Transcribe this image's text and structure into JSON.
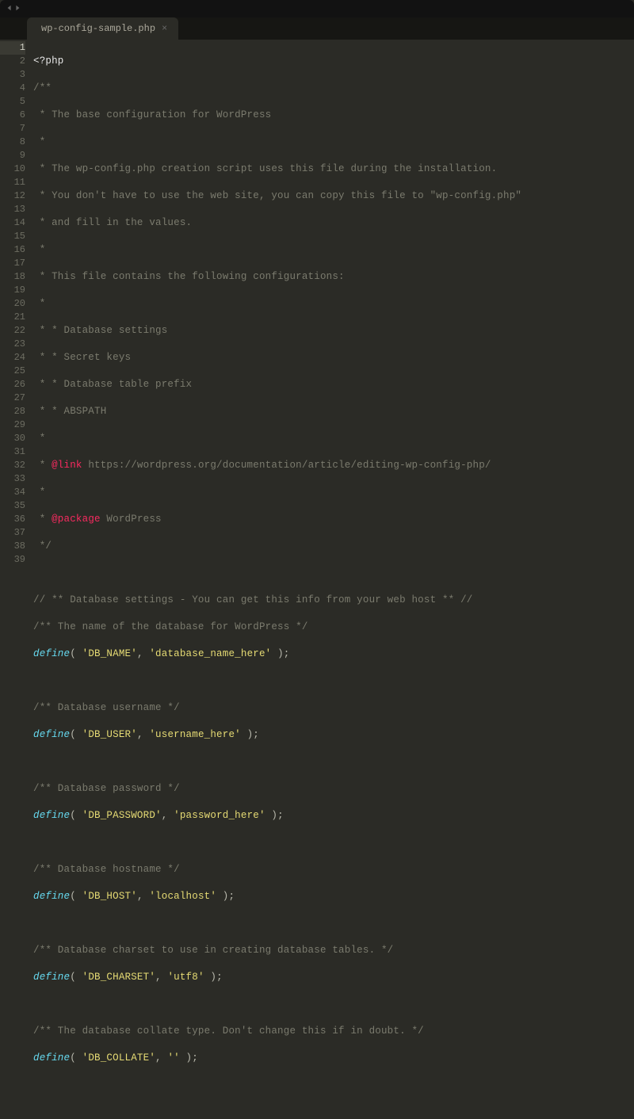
{
  "tab": {
    "filename": "wp-config-sample.php",
    "close": "×"
  },
  "nav": {
    "back": "◀",
    "forward": "▶"
  },
  "line_count": 39,
  "active_line": 1,
  "code": {
    "open_tag": "<?php",
    "doc": {
      "open": "/**",
      "l3": " * The base configuration for WordPress",
      "l4": " *",
      "l5": " * The wp-config.php creation script uses this file during the installation.",
      "l6": " * You don't have to use the web site, you can copy this file to \"wp-config.php\"",
      "l7": " * and fill in the values.",
      "l8": " *",
      "l9": " * This file contains the following configurations:",
      "l10": " *",
      "l11": " * * Database settings",
      "l12": " * * Secret keys",
      "l13": " * * Database table prefix",
      "l14": " * * ABSPATH",
      "l15": " *",
      "l16_pre": " * ",
      "l16_anno": "@link",
      "l16_post": " https://wordpress.org/documentation/article/editing-wp-config-php/",
      "l17": " *",
      "l18_pre": " * ",
      "l18_anno": "@package",
      "l18_post": " WordPress",
      "close": " */"
    },
    "c21": "// ** Database settings - You can get this info from your web host ** //",
    "c22": "/** The name of the database for WordPress */",
    "def": "define",
    "d23_a": "'DB_NAME'",
    "d23_b": "'database_name_here'",
    "c25": "/** Database username */",
    "d26_a": "'DB_USER'",
    "d26_b": "'username_here'",
    "c28": "/** Database password */",
    "d29_a": "'DB_PASSWORD'",
    "d29_b": "'password_here'",
    "c31": "/** Database hostname */",
    "d32_a": "'DB_HOST'",
    "d32_b": "'localhost'",
    "c34": "/** Database charset to use in creating database tables. */",
    "d35_a": "'DB_CHARSET'",
    "d35_b": "'utf8'",
    "c37": "/** The database collate type. Don't change this if in doubt. */",
    "d38_a": "'DB_COLLATE'",
    "d38_b": "''"
  }
}
